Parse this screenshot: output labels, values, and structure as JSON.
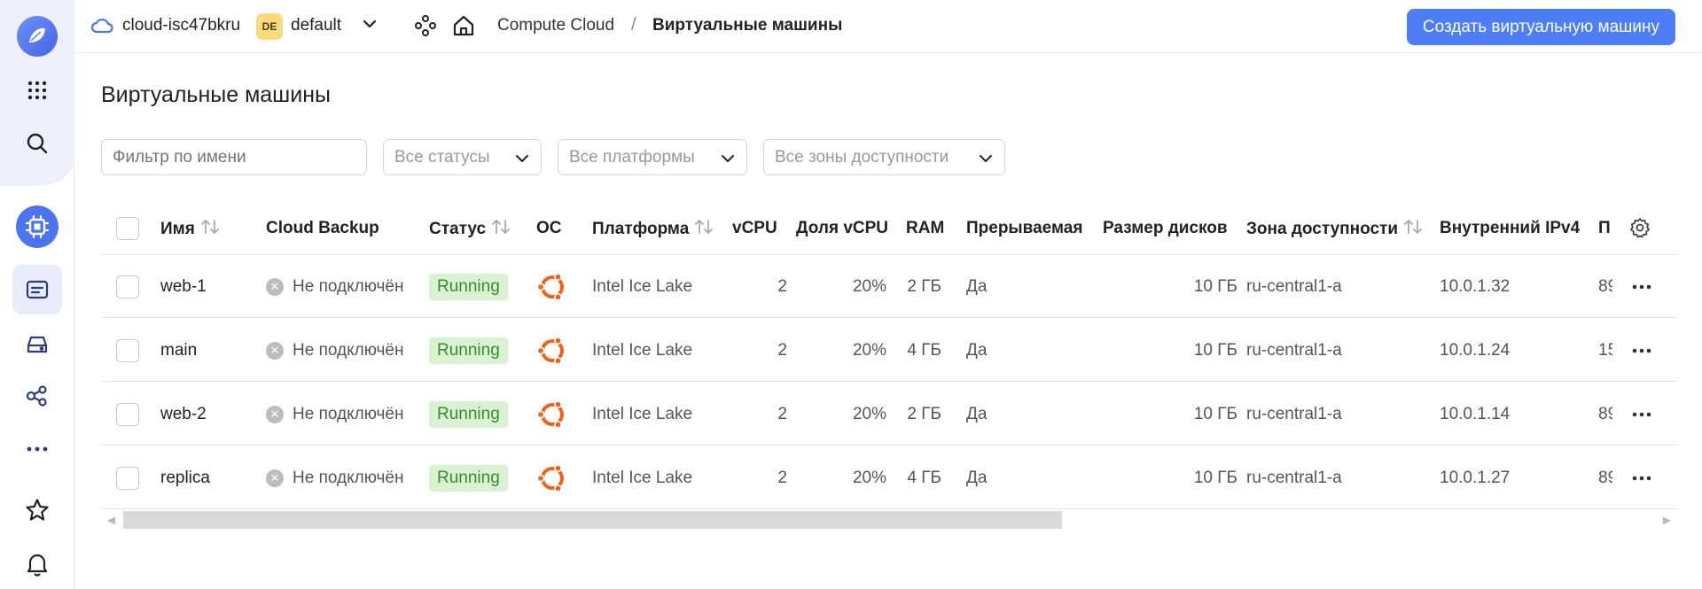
{
  "header": {
    "cloud_name": "cloud-isc47bkru",
    "folder_badge": "DE",
    "folder_name": "default",
    "breadcrumb_service": "Compute Cloud",
    "breadcrumb_separator": "/",
    "breadcrumb_current": "Виртуальные машины",
    "create_button": "Создать виртуальную машину"
  },
  "page": {
    "title": "Виртуальные машины"
  },
  "filters": {
    "name_placeholder": "Фильтр по имени",
    "status": "Все статусы",
    "platform": "Все платформы",
    "zone": "Все зоны доступности"
  },
  "table": {
    "columns": {
      "name": "Имя",
      "backup": "Cloud Backup",
      "status": "Статус",
      "os": "ОС",
      "platform": "Платформа",
      "vcpu": "vCPU",
      "vcpu_share": "Доля vCPU",
      "ram": "RAM",
      "preemptible": "Прерываемая",
      "disk_size": "Размер дисков",
      "zone": "Зона доступности",
      "ipv4": "Внутренний IPv4",
      "public_ip": "П"
    },
    "rows": [
      {
        "name": "web-1",
        "backup": "Не подключён",
        "status": "Running",
        "platform": "Intel Ice Lake",
        "vcpu": "2",
        "vcpu_share": "20%",
        "ram": "2 ГБ",
        "preemptible": "Да",
        "disk_size": "10 ГБ",
        "zone": "ru-central1-a",
        "ipv4": "10.0.1.32",
        "public_ip": "89"
      },
      {
        "name": "main",
        "backup": "Не подключён",
        "status": "Running",
        "platform": "Intel Ice Lake",
        "vcpu": "2",
        "vcpu_share": "20%",
        "ram": "4 ГБ",
        "preemptible": "Да",
        "disk_size": "10 ГБ",
        "zone": "ru-central1-a",
        "ipv4": "10.0.1.24",
        "public_ip": "15"
      },
      {
        "name": "web-2",
        "backup": "Не подключён",
        "status": "Running",
        "platform": "Intel Ice Lake",
        "vcpu": "2",
        "vcpu_share": "20%",
        "ram": "2 ГБ",
        "preemptible": "Да",
        "disk_size": "10 ГБ",
        "zone": "ru-central1-a",
        "ipv4": "10.0.1.14",
        "public_ip": "89"
      },
      {
        "name": "replica",
        "backup": "Не подключён",
        "status": "Running",
        "platform": "Intel Ice Lake",
        "vcpu": "2",
        "vcpu_share": "20%",
        "ram": "4 ГБ",
        "preemptible": "Да",
        "disk_size": "10 ГБ",
        "zone": "ru-central1-a",
        "ipv4": "10.0.1.27",
        "public_ip": "89"
      }
    ]
  },
  "colors": {
    "accent": "#4d7ef7",
    "status_running_bg": "#d9f2d2",
    "status_running_fg": "#3c8a2e",
    "os_ubuntu": "#e9661c"
  },
  "icons": {
    "rail": [
      "logo-icon",
      "apps-grid-icon",
      "search-icon",
      "compute-service-icon",
      "vm-icon",
      "disk-icon",
      "network-icon",
      "more-icon",
      "star-icon",
      "bell-icon"
    ]
  }
}
